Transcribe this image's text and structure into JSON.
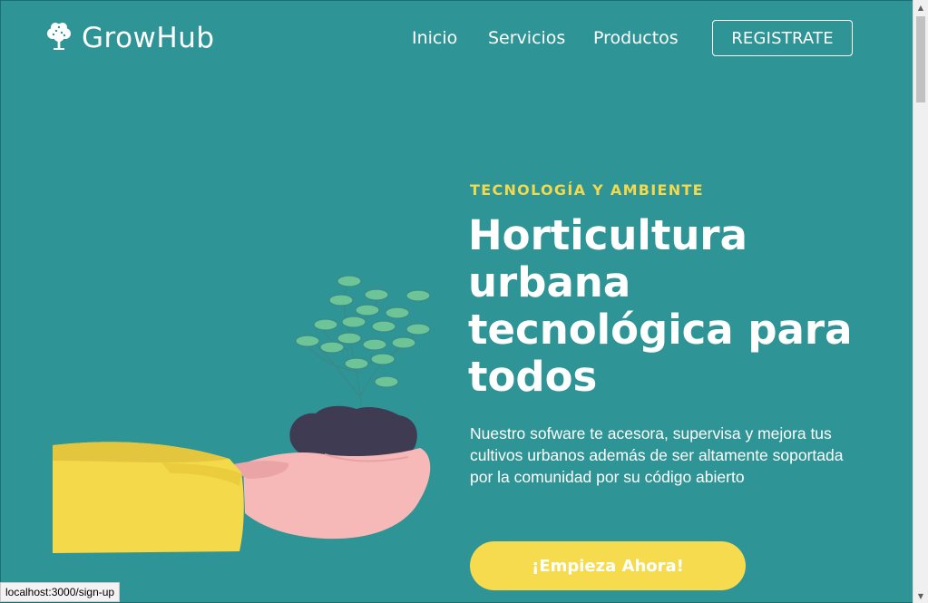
{
  "header": {
    "brand": "GrowHub",
    "nav": [
      {
        "label": "Inicio"
      },
      {
        "label": "Servicios"
      },
      {
        "label": "Productos"
      }
    ],
    "register_label": "REGISTRATE"
  },
  "hero": {
    "eyebrow": "TECNOLOGÍA Y AMBIENTE",
    "headline": "Horticultura urbana tecnológica para todos",
    "description": "Nuestro sofware te acesora, supervisa y mejora tus cultivos urbanos además de ser altamente soportada por la comunidad por su código abierto",
    "cta_label": "¡Empieza Ahora!"
  },
  "status_bar": {
    "url": "localhost:3000/sign-up"
  },
  "colors": {
    "background": "#2e9495",
    "accent_yellow": "#f5db4d",
    "eyebrow_yellow": "#f2d94e",
    "hand_pink": "#f7b9b8",
    "soil": "#3e3b52",
    "leaf": "#6cc497"
  },
  "icons": {
    "logo": "tree-icon"
  }
}
